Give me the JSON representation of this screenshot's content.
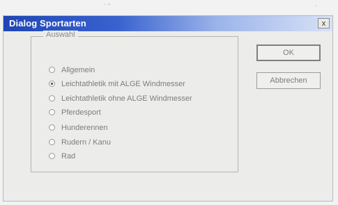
{
  "window": {
    "title": "Dialog Sportarten",
    "close_label": "x"
  },
  "group": {
    "label": "Auswahl",
    "options": [
      {
        "label": "Allgemein",
        "checked": false
      },
      {
        "label": "Leichtathletik mit ALGE Windmesser",
        "checked": true
      },
      {
        "label": "Leichtathletik ohne ALGE Windmesser",
        "checked": false
      },
      {
        "label": "Pferdesport",
        "checked": false
      },
      {
        "label": "Hunderennen",
        "checked": false
      },
      {
        "label": "Rudern / Kanu",
        "checked": false
      },
      {
        "label": "Rad",
        "checked": false
      }
    ]
  },
  "buttons": {
    "ok_label": "OK",
    "cancel_label": "Abbrechen"
  }
}
